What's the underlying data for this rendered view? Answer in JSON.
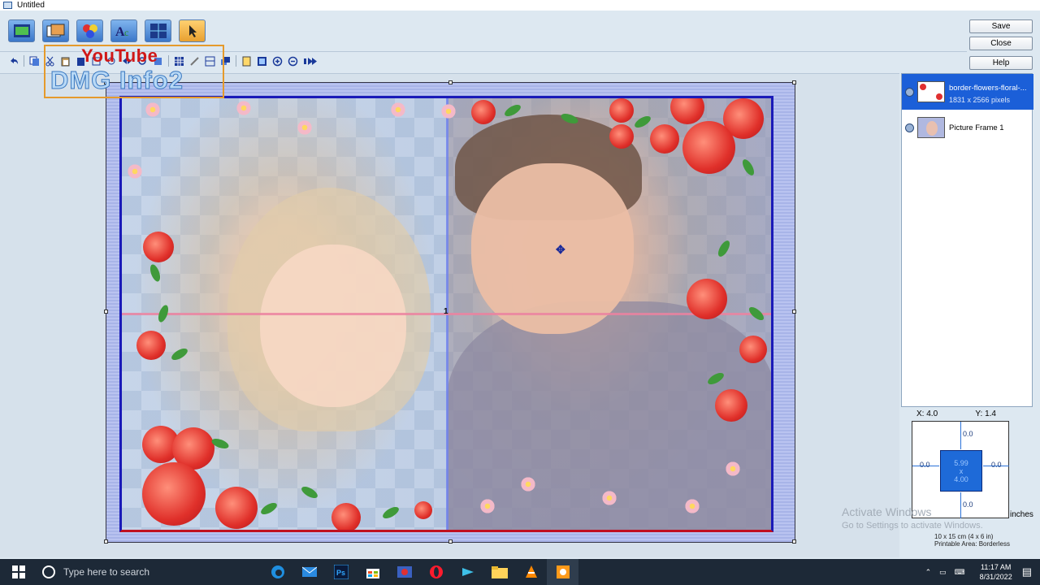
{
  "window": {
    "title": "Untitled"
  },
  "watermark": {
    "line1": "YouTube",
    "line2": "DMG Info2"
  },
  "right_buttons": {
    "save": "Save",
    "close": "Close",
    "help": "Help"
  },
  "canvas": {
    "frame_number": "1"
  },
  "layers": [
    {
      "name": "border-flowers-floral-...",
      "info": "1831 x 2566 pixels",
      "selected": true
    },
    {
      "name": "Picture Frame 1",
      "info": "",
      "selected": false
    }
  ],
  "position": {
    "x_label": "X: 4.0",
    "y_label": "Y: 1.4",
    "top": "0.0",
    "left": "0.0",
    "right": "0.0",
    "bottom": "0.0",
    "width": "5.99",
    "x_sep": "x",
    "height": "4.00",
    "unit": "inches"
  },
  "paper": {
    "size": "10 x 15 cm (4 x 6 in)",
    "area": "Printable Area: Borderless"
  },
  "activate": {
    "line1": "Activate Windows",
    "line2": "Go to Settings to activate Windows."
  },
  "taskbar": {
    "search_placeholder": "Type here to search",
    "time": "11:17 AM",
    "date": "8/31/2022"
  }
}
